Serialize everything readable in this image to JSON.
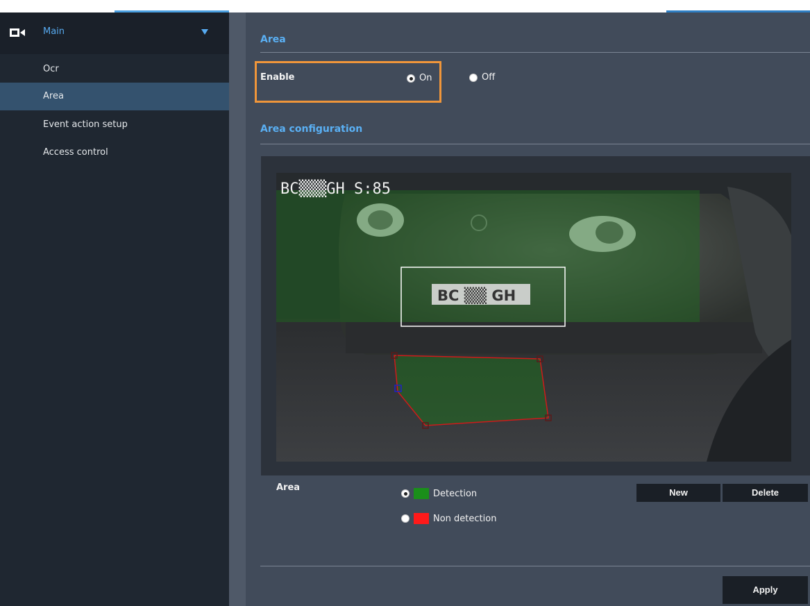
{
  "sidebar": {
    "header": "Main",
    "items": [
      {
        "label": "Ocr"
      },
      {
        "label": "Area",
        "active": true
      },
      {
        "label": "Event action setup"
      },
      {
        "label": "Access control"
      }
    ]
  },
  "main": {
    "area_section": {
      "title": "Area",
      "enable_label": "Enable",
      "on_label": "On",
      "off_label": "Off",
      "selected": "On"
    },
    "config_section": {
      "title": "Area configuration"
    },
    "video": {
      "overlay_text": "BC▒▒▒GH  S:85",
      "plate_text": "BC ▒▒ GH"
    },
    "area_controls": {
      "label": "Area",
      "detection_label": "Detection",
      "non_detection_label": "Non detection",
      "selected": "Detection",
      "detection_color": "#1a8f1a",
      "non_detection_color": "#ff1a1a",
      "new_label": "New",
      "delete_label": "Delete"
    },
    "apply_label": "Apply"
  },
  "colors": {
    "accent": "#5ab0f4",
    "highlight_border": "#f0963a",
    "sidebar_bg": "#1f2731",
    "sidebar_active": "#34526e",
    "main_bg": "#414b5a"
  }
}
